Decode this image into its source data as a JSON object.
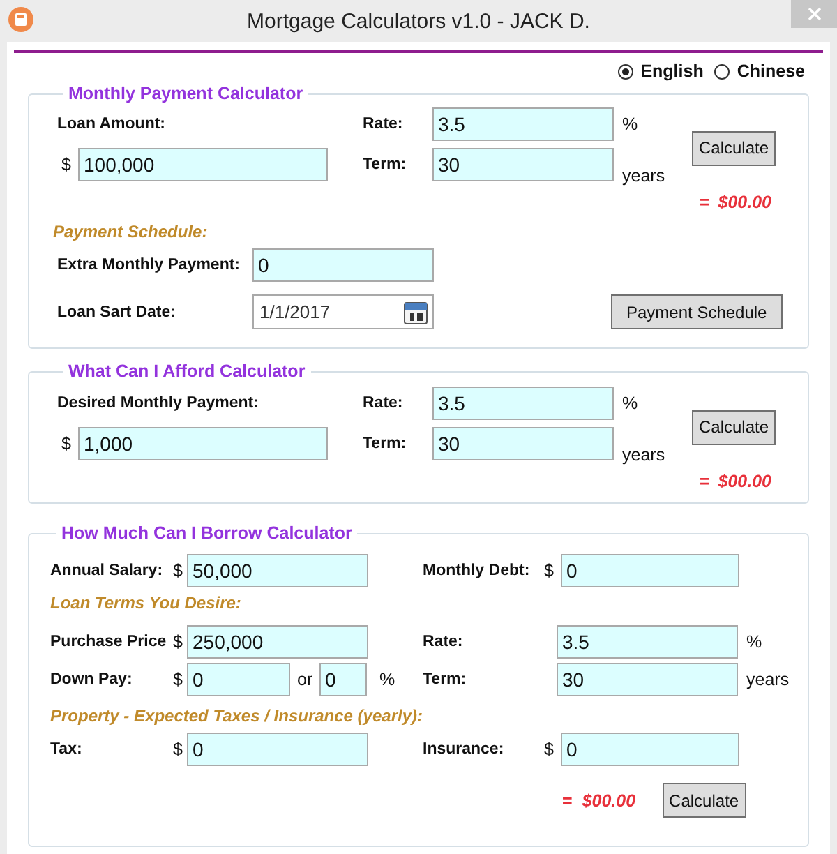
{
  "window": {
    "title": "Mortgage Calculators v1.0 - JACK D."
  },
  "languages": [
    {
      "label": "English",
      "selected": true
    },
    {
      "label": "Chinese",
      "selected": false
    }
  ],
  "monthly_payment": {
    "title": "Monthly Payment Calculator",
    "amount_label": "Loan Amount:",
    "currency": "$",
    "amount": "100,000",
    "rate_label": "Rate:",
    "rate": "3.5",
    "rate_unit": "%",
    "term_label": "Term:",
    "term": "30",
    "term_unit": "years",
    "calculate": "Calculate",
    "result_prefix": "=",
    "result": "$00.00",
    "schedule_heading": "Payment Schedule:",
    "extra_label": "Extra Monthly Payment:",
    "extra": "0",
    "start_label": "Loan Sart Date:",
    "start_date": "1/1/2017",
    "schedule_button": "Payment Schedule"
  },
  "afford": {
    "title": "What Can I Afford Calculator",
    "amount_label": "Desired Monthly Payment:",
    "currency": "$",
    "amount": "1,000",
    "rate_label": "Rate:",
    "rate": "3.5",
    "rate_unit": "%",
    "term_label": "Term:",
    "term": "30",
    "term_unit": "years",
    "calculate": "Calculate",
    "result_prefix": "=",
    "result": "$00.00"
  },
  "borrow": {
    "title": "How Much Can I Borrow Calculator",
    "salary_label": "Annual Salary:",
    "salary_currency": "$",
    "salary": "50,000",
    "debt_label": "Monthly Debt:",
    "debt_currency": "$",
    "debt": "0",
    "terms_heading": "Loan Terms You Desire:",
    "price_label": "Purchase Price",
    "price_currency": "$",
    "price": "250,000",
    "rate_label": "Rate:",
    "rate": "3.5",
    "rate_unit": "%",
    "down_label": "Down Pay:",
    "down_currency": "$",
    "down_amount": "0",
    "down_or": "or",
    "down_percent": "0",
    "down_percent_unit": "%",
    "term_label": "Term:",
    "term": "30",
    "term_unit": "years",
    "property_heading": "Property - Expected Taxes / Insurance (yearly):",
    "tax_label": "Tax:",
    "tax_currency": "$",
    "tax": "0",
    "insurance_label": "Insurance:",
    "insurance_currency": "$",
    "insurance": "0",
    "result_prefix": "=",
    "result": "$00.00",
    "calculate": "Calculate"
  }
}
